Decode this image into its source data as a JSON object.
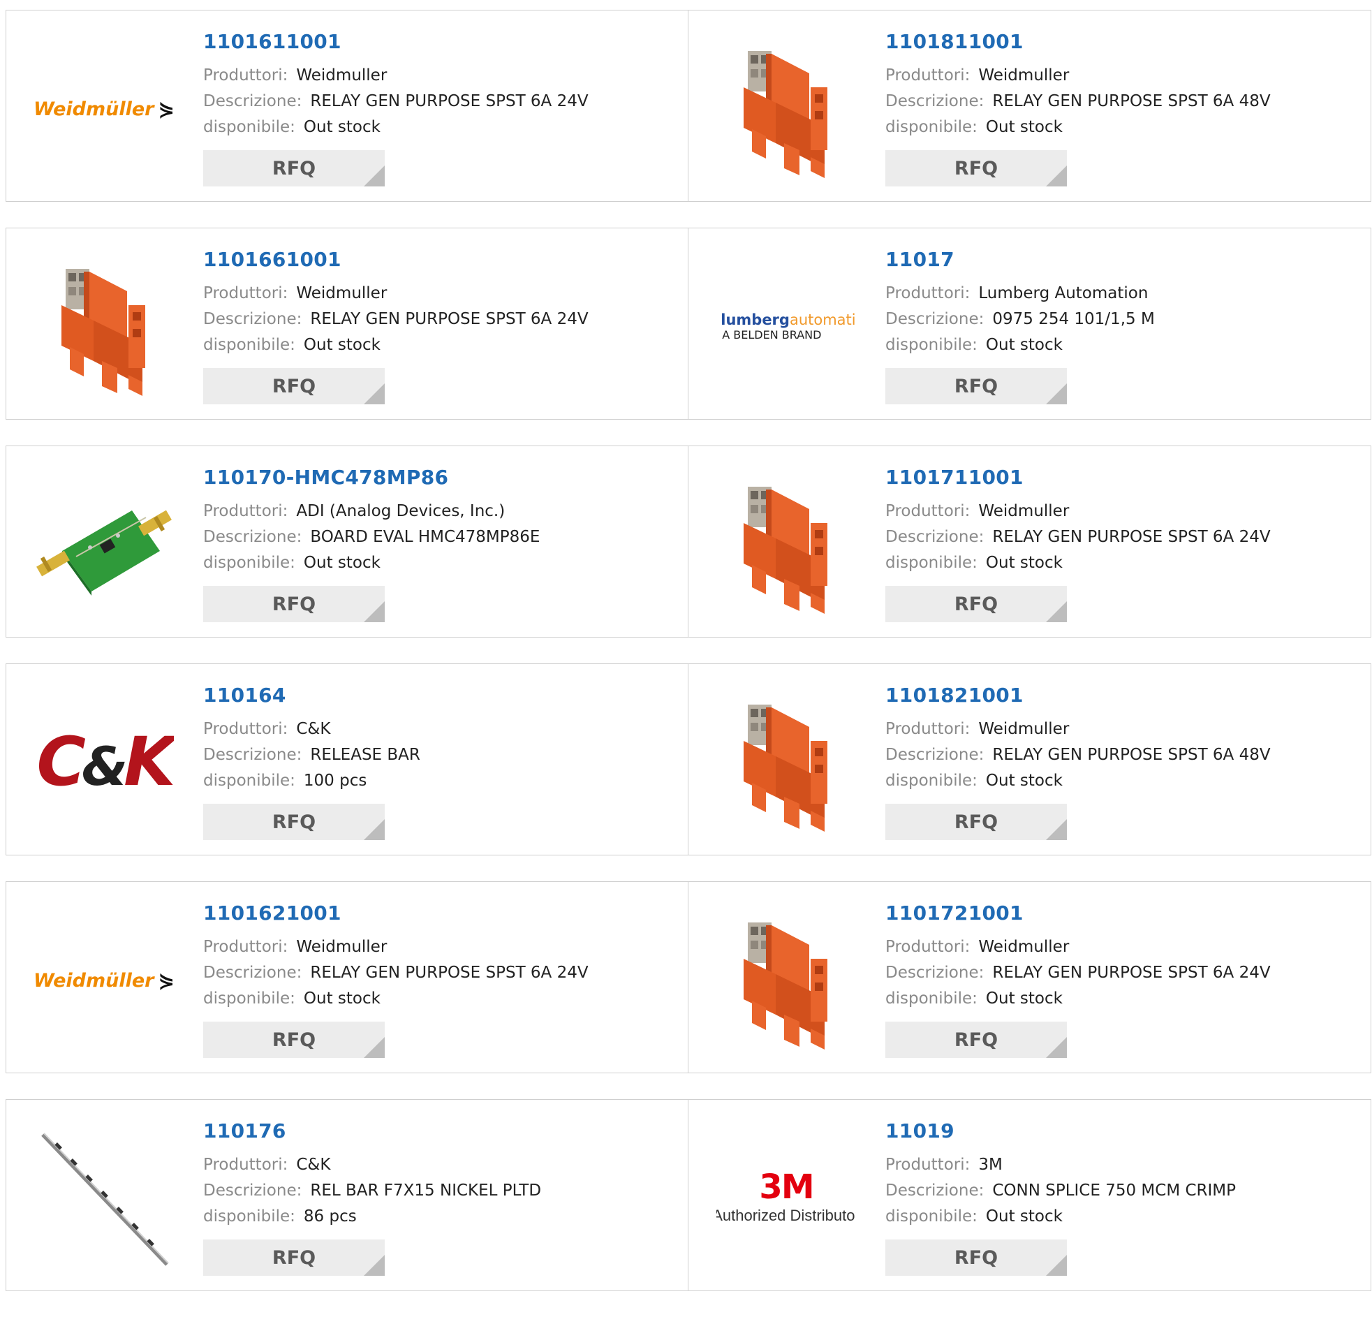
{
  "labels": {
    "manufacturer": "Produttori:",
    "description": "Descrizione:",
    "availability": "disponibile:",
    "rfq": "RFQ"
  },
  "products": [
    {
      "part": "1101611001",
      "manufacturer": "Weidmuller",
      "description": "RELAY GEN PURPOSE SPST 6A 24V",
      "availability": "Out stock",
      "image": "weidmuller-logo"
    },
    {
      "part": "1101811001",
      "manufacturer": "Weidmuller",
      "description": "RELAY GEN PURPOSE SPST 6A 48V",
      "availability": "Out stock",
      "image": "relay-photo"
    },
    {
      "part": "1101661001",
      "manufacturer": "Weidmuller",
      "description": "RELAY GEN PURPOSE SPST 6A 24V",
      "availability": "Out stock",
      "image": "relay-photo"
    },
    {
      "part": "11017",
      "manufacturer": "Lumberg Automation",
      "description": "0975 254 101/1,5 M",
      "availability": "Out stock",
      "image": "lumberg-logo"
    },
    {
      "part": "110170-HMC478MP86",
      "manufacturer": "ADI (Analog Devices, Inc.)",
      "description": "BOARD EVAL HMC478MP86E",
      "availability": "Out stock",
      "image": "eval-board-photo"
    },
    {
      "part": "1101711001",
      "manufacturer": "Weidmuller",
      "description": "RELAY GEN PURPOSE SPST 6A 24V",
      "availability": "Out stock",
      "image": "relay-photo"
    },
    {
      "part": "110164",
      "manufacturer": "C&K",
      "description": "RELEASE BAR",
      "availability": "100 pcs",
      "image": "ck-logo"
    },
    {
      "part": "1101821001",
      "manufacturer": "Weidmuller",
      "description": "RELAY GEN PURPOSE SPST 6A 48V",
      "availability": "Out stock",
      "image": "relay-photo"
    },
    {
      "part": "1101621001",
      "manufacturer": "Weidmuller",
      "description": "RELAY GEN PURPOSE SPST 6A 24V",
      "availability": "Out stock",
      "image": "weidmuller-logo"
    },
    {
      "part": "1101721001",
      "manufacturer": "Weidmuller",
      "description": "RELAY GEN PURPOSE SPST 6A 24V",
      "availability": "Out stock",
      "image": "relay-photo"
    },
    {
      "part": "110176",
      "manufacturer": "C&K",
      "description": "REL BAR F7X15 NICKEL PLTD",
      "availability": "86 pcs",
      "image": "release-bar-photo"
    },
    {
      "part": "11019",
      "manufacturer": "3M",
      "description": "CONN SPLICE 750 MCM CRIMP",
      "availability": "Out stock",
      "image": "3m-logo"
    }
  ],
  "logos": {
    "weidmuller": {
      "text": "Weidmüller",
      "mark": "⋟"
    },
    "ck": {
      "c": "C",
      "amp": "&",
      "k": "K"
    },
    "lumberg": {
      "icon": "@",
      "t1": "lumberg",
      "t2": "automation",
      "sub": "A BELDEN BRAND"
    },
    "threem": {
      "big": "3M",
      "small": "Authorized Distributor"
    }
  },
  "colors": {
    "part_link": "#1f6ab4",
    "label": "#8a8a8a",
    "rfq_bg": "#ececec",
    "weidmuller_orange": "#f08a00",
    "ck_red": "#b3141c",
    "threem_red": "#e3000f",
    "relay_orange": "#e8642c"
  }
}
